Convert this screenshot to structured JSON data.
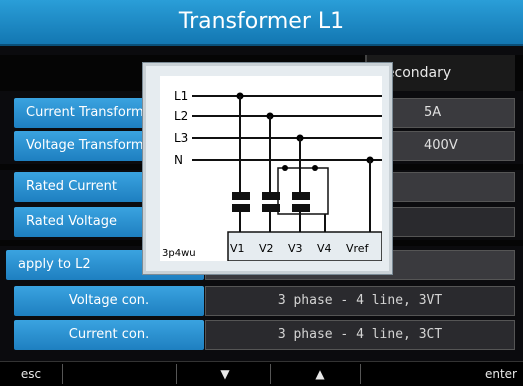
{
  "title": "Transformer L1",
  "header": {
    "secondary_col": "Secondary"
  },
  "rows": {
    "current_transformer": {
      "label": "Current Transformer",
      "value": "5A"
    },
    "voltage_transformer": {
      "label": "Voltage Transformer",
      "value": "400V"
    },
    "rated_current": {
      "label": "Rated Current",
      "value": ""
    },
    "rated_voltage": {
      "label": "Rated Voltage",
      "value": ""
    },
    "apply_to": {
      "label": "apply to L2",
      "value": ""
    },
    "voltage_con": {
      "label": "Voltage con.",
      "value": "3 phase - 4 line, 3VT"
    },
    "current_con": {
      "label": "Current con.",
      "value": "3 phase - 4 line, 3CT"
    }
  },
  "diagram": {
    "lines": [
      "L1",
      "L2",
      "L3",
      "N"
    ],
    "terminals": [
      "V1",
      "V2",
      "V3",
      "V4",
      "Vref"
    ],
    "mode_label": "3p4wu"
  },
  "footer": {
    "esc": "esc",
    "down": "▼",
    "up": "▲",
    "enter": "enter"
  }
}
